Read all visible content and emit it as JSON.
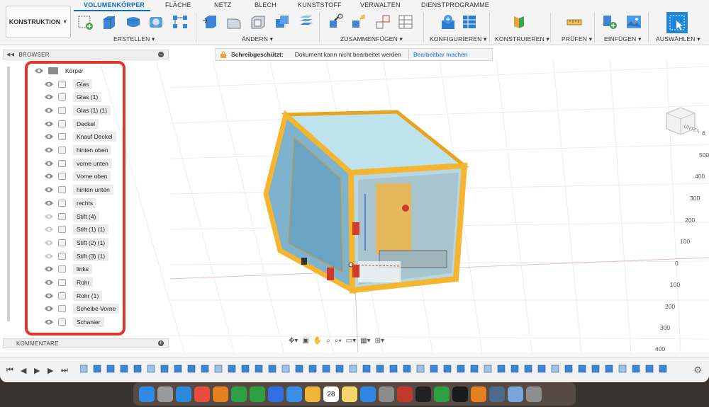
{
  "toolbar": {
    "workspace_label": "KONSTRUKTION",
    "tabs": [
      "VOLUMENKÖRPER",
      "FLÄCHE",
      "NETZ",
      "BLECH",
      "KUNSTSTOFF",
      "VERWALTEN",
      "DIENSTPROGRAMME"
    ],
    "groups": [
      "ERSTELLEN",
      "ÄNDERN",
      "ZUSAMMENFÜGEN",
      "KONFIGURIEREN",
      "KONSTRUIEREN",
      "PRÜFEN",
      "EINFÜGEN",
      "AUSWÄHLEN"
    ]
  },
  "browser": {
    "title": "BROWSER",
    "root": "Körper",
    "items": [
      "Glas",
      "Glas (1)",
      "Glas (1) (1)",
      "Deckel",
      "Knauf Deckel",
      "hinten oben",
      "vorne unten",
      "Vorne oben",
      "hinten unten",
      "rechts",
      "Stift (4)",
      "Stift (1) (1)",
      "Stift (2) (1)",
      "Stift (3) (1)",
      "links",
      "Rohr",
      "Rohr (1)",
      "Scheibe Vorne",
      "Schanier"
    ],
    "hidden_items": [
      "Stift (4)",
      "Stift (1) (1)",
      "Stift (2) (1)",
      "Stift (3) (1)"
    ]
  },
  "comments": {
    "title": "KOMMENTARE"
  },
  "readonly": {
    "title": "Schreibgeschützt:",
    "message": "Dokument kann nicht bearbeitet werden",
    "action": "Bearbeitbar machen"
  },
  "viewcube": {
    "face_label": "UNTEN"
  },
  "axis_labels": [
    "6",
    "500",
    "400",
    "300",
    "200",
    "100",
    "0",
    "100",
    "200",
    "300",
    "400"
  ],
  "colors": {
    "accent": "#0f6fc7",
    "highlight": "#e0362c",
    "frame": "#f5b52e",
    "glass": "#8fc0d6"
  },
  "dock_apps": [
    "finder-icon",
    "launchpad-icon",
    "safari-icon",
    "chrome-icon",
    "app-icon",
    "numbers-icon",
    "numbers-icon",
    "affinity-icon",
    "mail-icon",
    "photos-icon",
    "calendar-icon",
    "notes-icon",
    "appstore-icon",
    "settings-icon",
    "app-icon",
    "terminal-icon",
    "numbers-icon",
    "app-icon",
    "app-icon",
    "preview-icon",
    "folder-icon",
    "trash-icon"
  ],
  "calendar_day": "28"
}
